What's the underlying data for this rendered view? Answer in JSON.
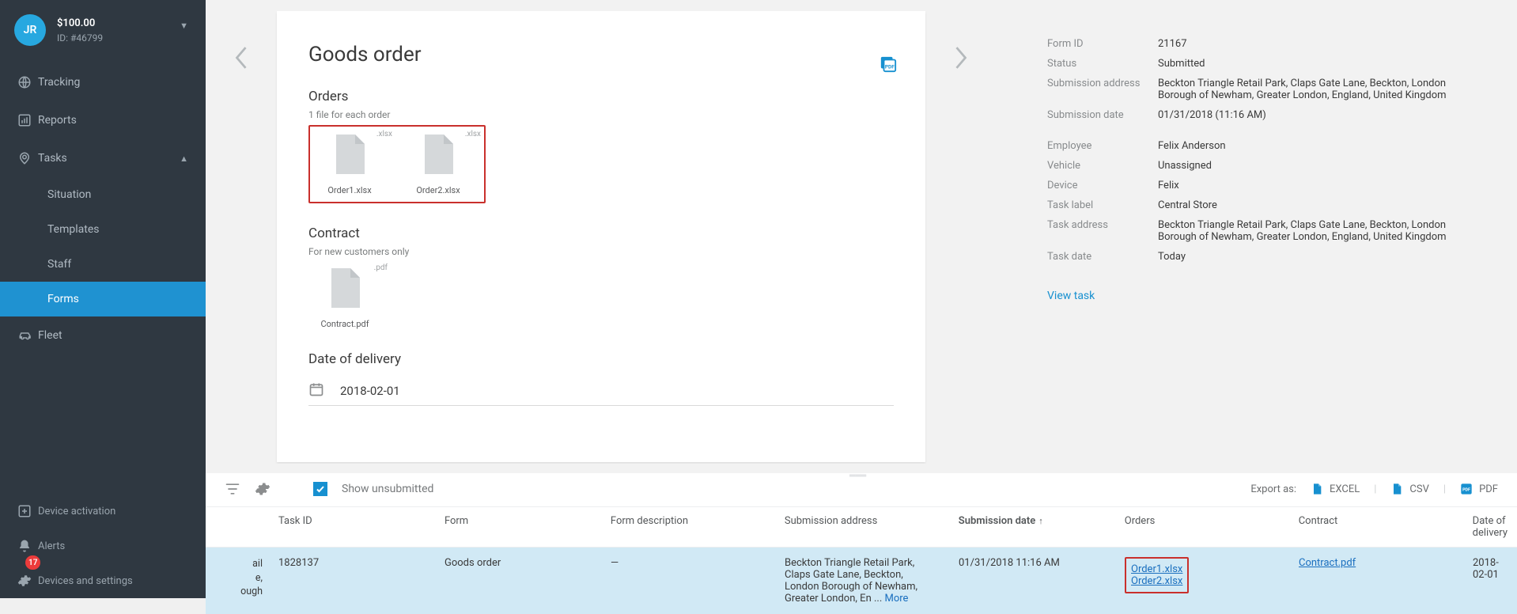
{
  "sidebar": {
    "avatar_initials": "JR",
    "balance": "$100.00",
    "user_id_label": "ID: #46799",
    "items": {
      "tracking": "Tracking",
      "reports": "Reports",
      "tasks": "Tasks",
      "situation": "Situation",
      "templates": "Templates",
      "staff": "Staff",
      "forms": "Forms",
      "fleet": "Fleet"
    },
    "bottom": {
      "device_activation": "Device activation",
      "alerts": "Alerts",
      "alerts_badge": "17",
      "settings": "Devices and settings"
    }
  },
  "card": {
    "title": "Goods order",
    "orders_heading": "Orders",
    "orders_note": "1 file for each order",
    "order_file_1": "Order1.xlsx",
    "order_file_1_ext": ".xlsx",
    "order_file_2": "Order2.xlsx",
    "order_file_2_ext": ".xlsx",
    "contract_heading": "Contract",
    "contract_note": "For new customers only",
    "contract_file": "Contract.pdf",
    "contract_file_ext": ".pdf",
    "date_heading": "Date of delivery",
    "date_value": "2018-02-01"
  },
  "info": {
    "keys": {
      "form_id": "Form ID",
      "status": "Status",
      "sub_addr": "Submission address",
      "sub_date": "Submission date",
      "employee": "Employee",
      "vehicle": "Vehicle",
      "device": "Device",
      "task_label": "Task label",
      "task_addr": "Task address",
      "task_date": "Task date"
    },
    "vals": {
      "form_id": "21167",
      "status": "Submitted",
      "sub_addr": "Beckton Triangle Retail Park, Claps Gate Lane, Beckton, London Borough of Newham, Greater London, England, United Kingdom",
      "sub_date": "01/31/2018 (11:16 AM)",
      "employee": "Felix Anderson",
      "vehicle": "Unassigned",
      "device": "Felix",
      "task_label": "Central Store",
      "task_addr": "Beckton Triangle Retail Park, Claps Gate Lane, Beckton, London Borough of Newham, Greater London, England, United Kingdom",
      "task_date": "Today"
    },
    "view_task": "View task"
  },
  "table": {
    "toolbar": {
      "show_unsubmitted": "Show unsubmitted",
      "export_as": "Export as:",
      "excel": "EXCEL",
      "csv": "CSV",
      "pdf": "PDF"
    },
    "headers": {
      "task_id": "Task ID",
      "form": "Form",
      "form_desc": "Form description",
      "sub_addr": "Submission address",
      "sub_date": "Submission date",
      "orders": "Orders",
      "contract": "Contract",
      "deliv": "Date of delivery"
    },
    "row": {
      "colA_l1": "ail",
      "colA_l2": "e,",
      "colA_l3": "ough",
      "task_id": "1828137",
      "form": "Goods order",
      "form_desc": "—",
      "sub_addr_a": "Beckton Triangle Retail Park, Claps Gate Lane, Beckton, London Borough of Newham, Greater London, En ... ",
      "sub_addr_more": "More",
      "sub_date": "01/31/2018 11:16 AM",
      "order_link_1": "Order1.xlsx",
      "order_link_2": "Order2.xlsx",
      "contract_link": "Contract.pdf",
      "deliv": "2018-02-01"
    }
  }
}
